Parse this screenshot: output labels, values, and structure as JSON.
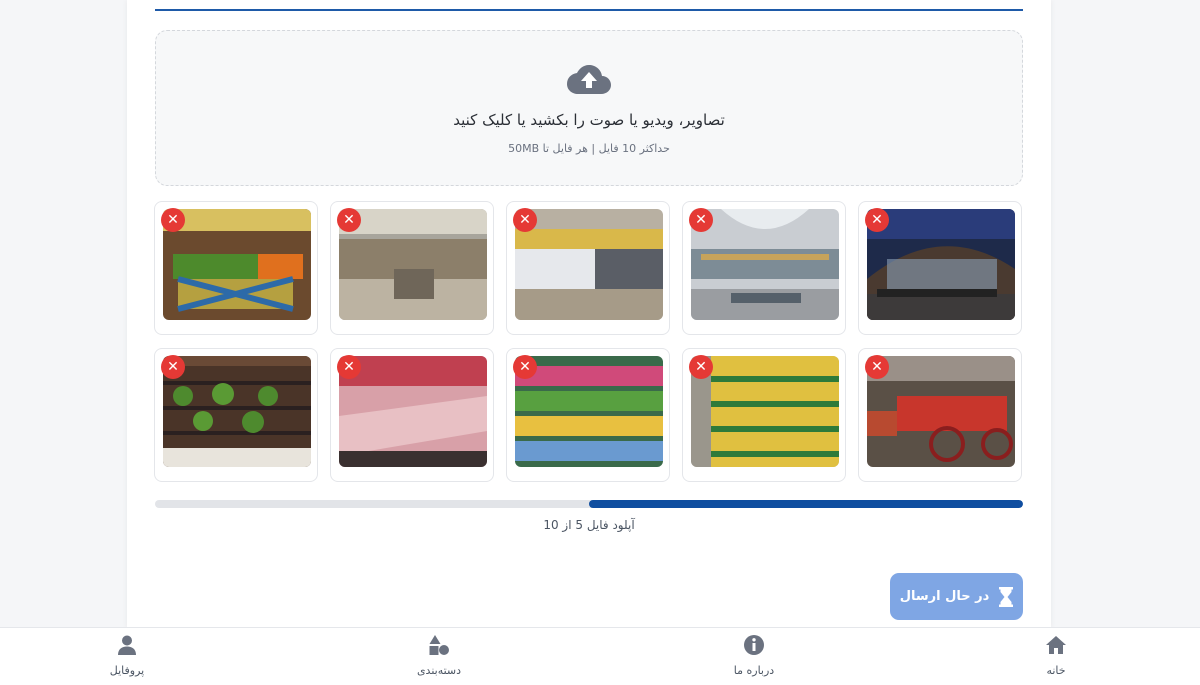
{
  "upload": {
    "title": "تصاویر، ویدیو یا صوت را بکشید یا کلیک کنید",
    "hint": "حداکثر 10 فایل | هر فایل تا 50MB"
  },
  "files": [
    {
      "remove": "✕",
      "thumb": "mall-exterior"
    },
    {
      "remove": "✕",
      "thumb": "mall-atrium"
    },
    {
      "remove": "✕",
      "thumb": "mall-store-front"
    },
    {
      "remove": "✕",
      "thumb": "mall-corridor"
    },
    {
      "remove": "✕",
      "thumb": "produce-display"
    },
    {
      "remove": "✕",
      "thumb": "fruit-cart"
    },
    {
      "remove": "✕",
      "thumb": "oil-shelves"
    },
    {
      "remove": "✕",
      "thumb": "snack-shelves"
    },
    {
      "remove": "✕",
      "thumb": "meat-counter"
    },
    {
      "remove": "✕",
      "thumb": "plant-shelves"
    }
  ],
  "progress": {
    "text": "آپلود فایل 5 از 10",
    "current": 5,
    "total": 10
  },
  "submit": {
    "label": "در حال ارسال",
    "icon": "hourglass-icon"
  },
  "nav": {
    "home": "خانه",
    "about": "درباره ما",
    "categories": "دسته‌بندی",
    "profile": "پروفایل"
  },
  "colors": {
    "accent": "#0f4ea0",
    "button": "#7fa6e4",
    "remove": "#e53935"
  }
}
